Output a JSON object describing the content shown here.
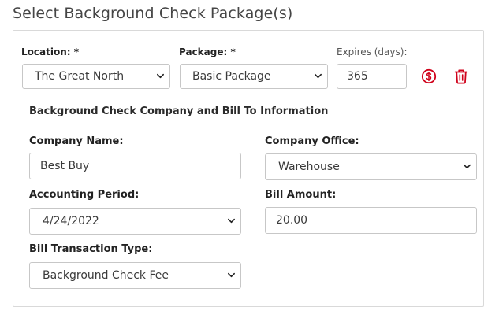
{
  "page": {
    "title": "Select Background Check Package(s)"
  },
  "package_row": {
    "location": {
      "label": "Location: *",
      "value": "The Great North"
    },
    "package": {
      "label": "Package: *",
      "value": "Basic Package"
    },
    "expires": {
      "label": "Expires (days):",
      "value": "365"
    }
  },
  "billing": {
    "section_title": "Background Check Company and Bill To Information",
    "company_name": {
      "label": "Company Name:",
      "value": "Best Buy"
    },
    "company_office": {
      "label": "Company Office:",
      "value": "Warehouse"
    },
    "accounting_period": {
      "label": "Accounting Period:",
      "value": "4/24/2022"
    },
    "bill_amount": {
      "label": "Bill Amount:",
      "value": "20.00"
    },
    "bill_transaction_type": {
      "label": "Bill Transaction Type:",
      "value": "Background Check Fee"
    }
  },
  "icons": {
    "billing": "dollar-circle-icon",
    "delete": "trash-icon",
    "accent": "#d0021b"
  }
}
